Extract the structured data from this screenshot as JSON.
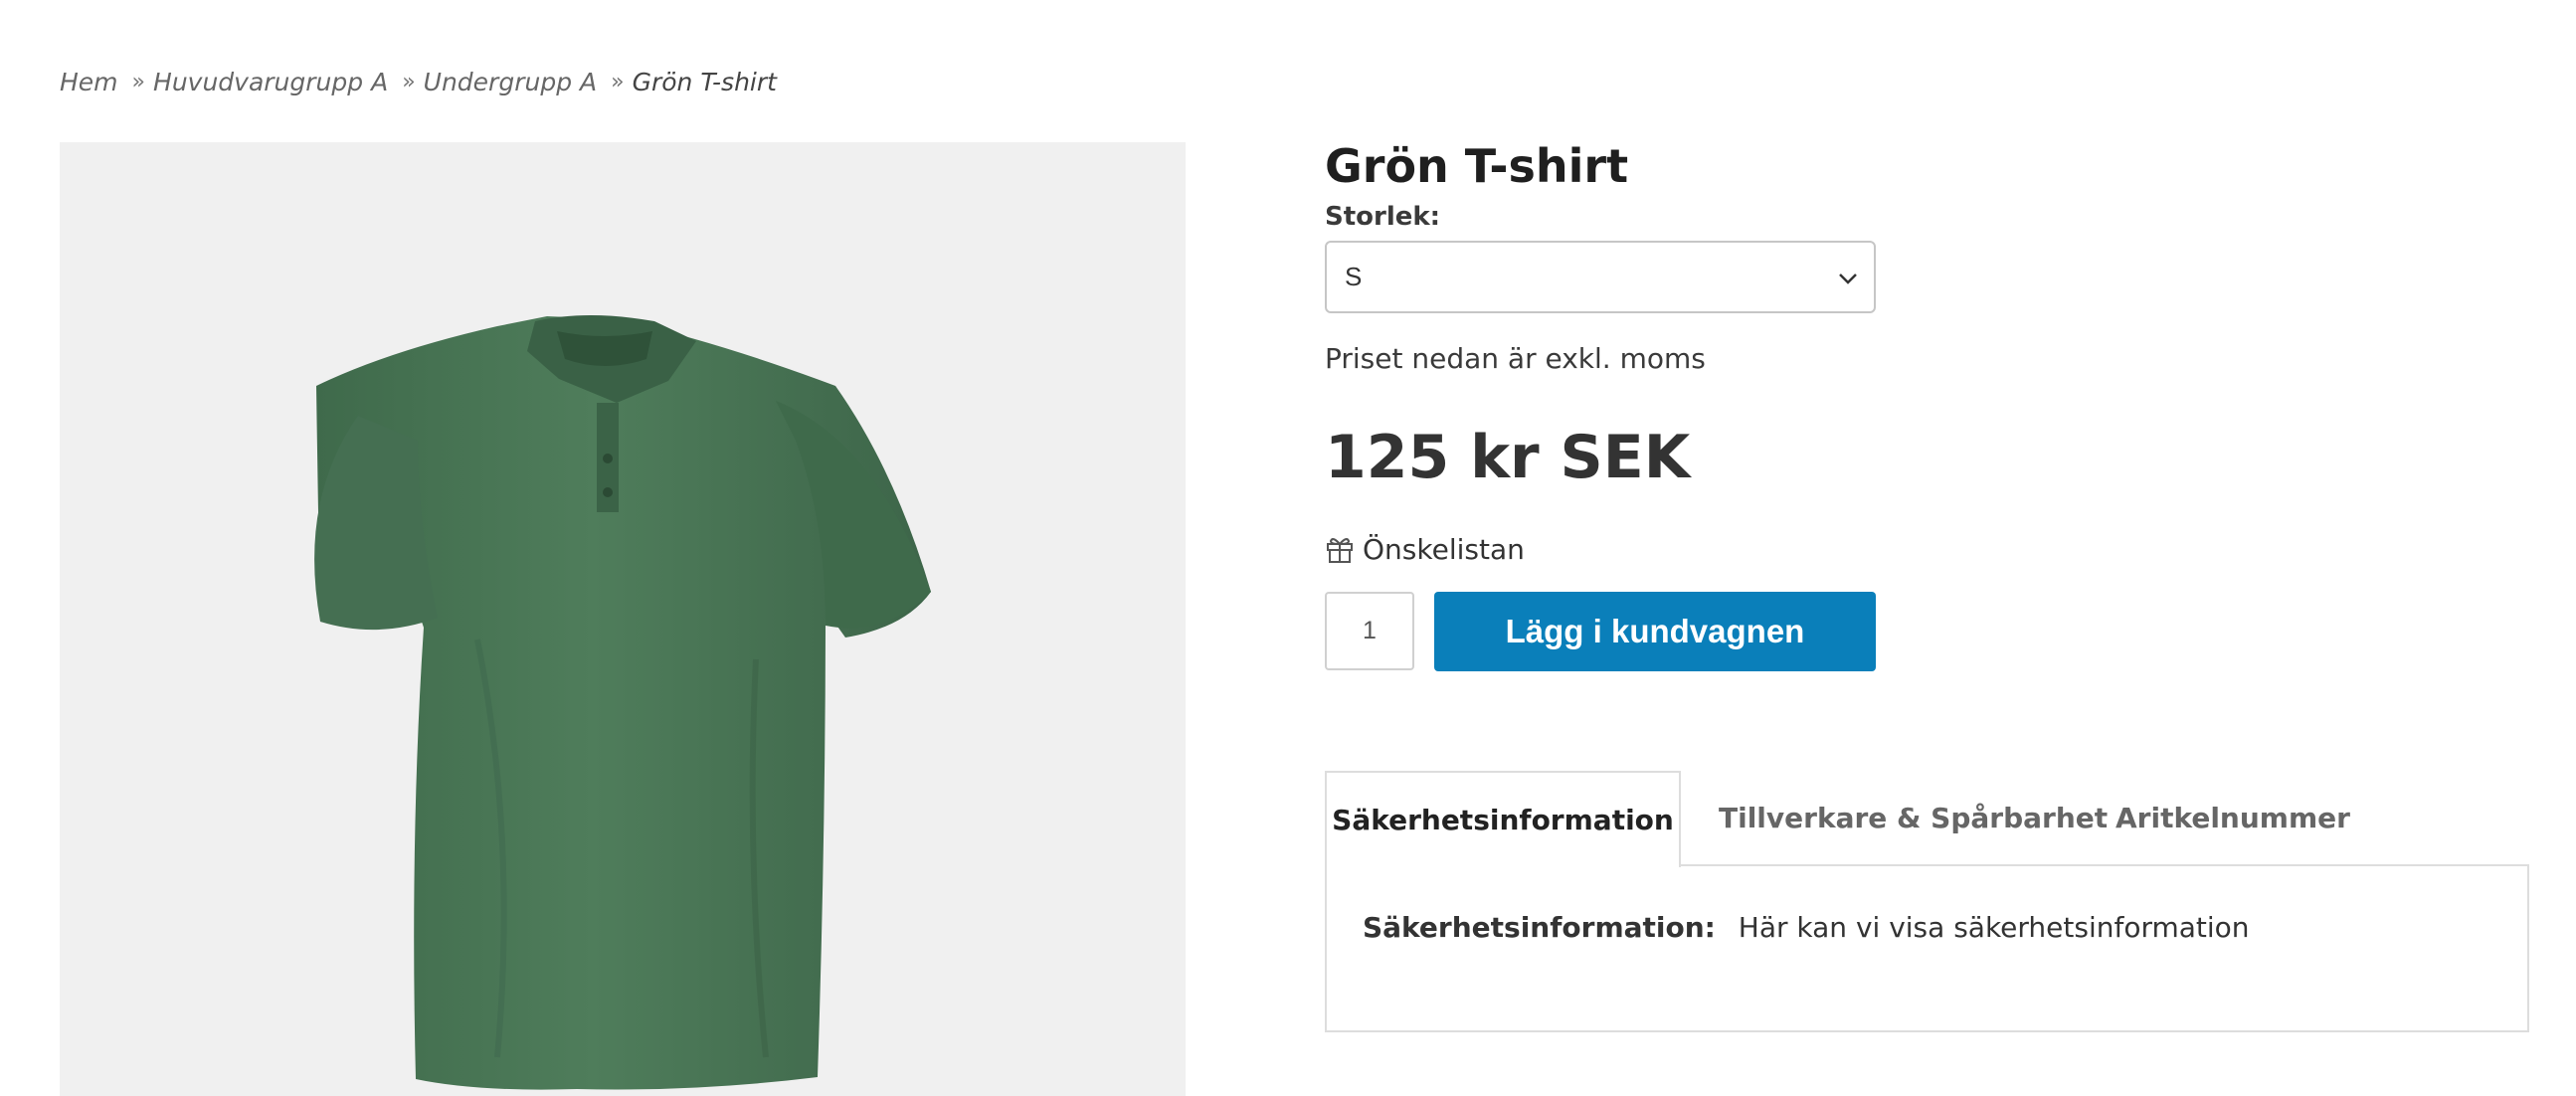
{
  "breadcrumb": {
    "items": [
      "Hem",
      "Huvudvarugrupp A",
      "Undergrupp A"
    ],
    "separator": "»",
    "current": "Grön T-shirt"
  },
  "product": {
    "title": "Grön T-shirt",
    "image_icon": "green-polo-shirt",
    "size_label": "Storlek:",
    "size_selected": "S",
    "vat_note": "Priset nedan är exkl. moms",
    "price": "125 kr SEK",
    "wishlist_label": "Önskelistan",
    "wishlist_icon": "gift-icon",
    "quantity": "1",
    "add_to_cart_label": "Lägg i kundvagnen",
    "accent_color": "#0a7fba"
  },
  "tabs": {
    "items": [
      "Säkerhetsinformation",
      "Tillverkare & Spårbarhet",
      "Aritkelnummer"
    ],
    "active_index": 0,
    "content_label": "Säkerhetsinformation:",
    "content_text": "Här kan vi visa säkerhetsinformation"
  }
}
